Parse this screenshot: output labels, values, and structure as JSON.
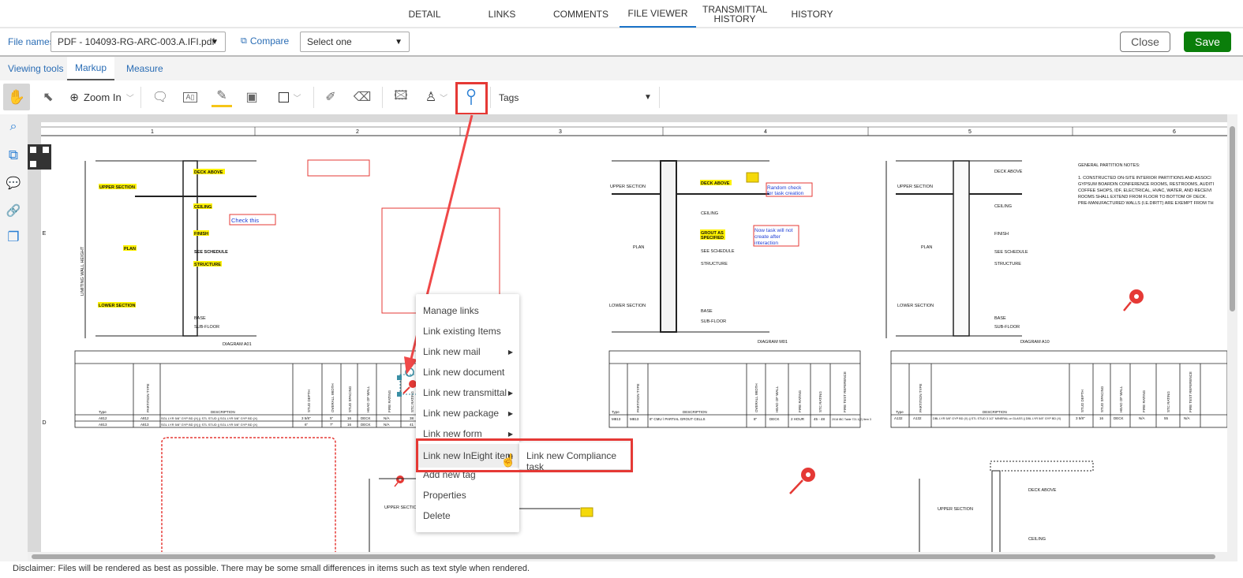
{
  "top_tabs": [
    "DETAIL",
    "LINKS",
    "COMMENTS",
    "FILE VIEWER",
    "TRANSMITTAL HISTORY",
    "HISTORY"
  ],
  "active_top_tab": "FILE VIEWER",
  "file_bar": {
    "label": "File names:",
    "file_value": "PDF - 104093-RG-ARC-003.A.IFI.pdf",
    "compare_label": "Compare",
    "compare_value": "Select one",
    "close_label": "Close",
    "save_label": "Save"
  },
  "sub_tabs": [
    "Viewing tools",
    "Markup",
    "Measure"
  ],
  "active_sub_tab": "Markup",
  "toolbar": {
    "zoom_label": "Zoom In",
    "tags_placeholder": "Tags"
  },
  "colors": {
    "save": "#0a7e0a",
    "accent": "#1a73c8",
    "highlight_red": "#e53935"
  },
  "drawing": {
    "column_numbers": [
      "1",
      "2",
      "3",
      "4",
      "5",
      "6"
    ],
    "row_letters": [
      "E",
      "D"
    ],
    "diagram_a": {
      "labels": [
        "DECK ABOVE",
        "UPPER SECTION",
        "CEILING",
        "FINISH",
        "PLAN",
        "SEE SCHEDULE",
        "STRUCTURE",
        "LOWER SECTION",
        "BASE",
        "SUB-FLOOR",
        "DIAGRAM A01",
        "LIMITING WALL HEIGHT"
      ]
    },
    "diagram_m": {
      "labels": [
        "DECK ABOVE",
        "UPPER SECTION",
        "CEILING",
        "GROUT AS",
        "SPECIFIED",
        "PLAN",
        "SEE SCHEDULE",
        "STRUCTURE",
        "LOWER SECTION",
        "BASE",
        "SUB-FLOOR",
        "DIAGRAM M01"
      ]
    },
    "diagram_a10": {
      "labels": [
        "DECK ABOVE",
        "UPPER SECTION",
        "CEILING",
        "FINISH",
        "PLAN",
        "SEE SCHEDULE",
        "STRUCTURE",
        "LOWER SECTION",
        "BASE",
        "SUB-FLOOR",
        "DIAGRAM A10"
      ]
    },
    "notes": [
      "GENERAL PARTITION NOTES:",
      "1. CONSTRUCTED ON-SITE INTERIOR PARTITIONS AND ASSOCI",
      "GYPSUM BOARDIN CONFERENCE ROOMS, RESTROOMS, AUDITI",
      "COFFEE SHOPS, IDF, ELECTRICAL, HVAC, WATER, AND RECEIVI",
      "ROOMS SHALL EXTEND FROM FLOOR TO BOTTOM OF DECK.",
      "PRE-MANUFACTURED WALLS (I.E.DIRTT) ARE EXEMPT FROM TH"
    ],
    "annotations": {
      "check_this": "Check this",
      "random_check": [
        "Random check",
        "for task creation"
      ],
      "now_task": [
        "Now task will not",
        "create after",
        "interaction"
      ]
    },
    "table1": {
      "headers": [
        "Type",
        "PARTITION TYPE",
        "DESCRIPTION",
        "STUD DEPTH",
        "OVERALL WIDTH",
        "STUD SPACING",
        "HEAD OF WALL",
        "FIRE RATING",
        "STC RATING"
      ],
      "rows": [
        [
          "A812",
          "A812",
          "SGL LYR 5/8\" GYP BD (X) || STL STUD || SGL LYR 5/8\" GYP BD (X)",
          "3 5/8\"",
          "5\"",
          "16",
          "DECK",
          "N/A",
          "38"
        ],
        [
          "A813",
          "A813",
          "SGL LYR 5/8\" GYP BD (X) || STL STUD || SGL LYR 5/8\" GYP BD (X)",
          "6\"",
          "7\"",
          "16",
          "DECK",
          "N/A",
          "41"
        ]
      ]
    },
    "table2": {
      "headers": [
        "Type",
        "PARTITION TYPE",
        "DESCRIPTION",
        "OVERALL WIDTH",
        "HEAD OF WALL",
        "FIRE RATING",
        "STC RATING",
        "FIRE TEST REFERENCE"
      ],
      "rows": [
        [
          "M813",
          "M813",
          "8\" CMU \\ PARTIAL GROUT CELLS",
          "8\"",
          "DECK",
          "2 HOUR",
          "45 - 48",
          "2018 IBC Table 721.1(2) Item 3"
        ]
      ]
    },
    "table3": {
      "headers": [
        "Type",
        "PARTITION TYPE",
        "DESCRIPTION",
        "STUD DEPTH",
        "STUD SPACING",
        "HEAD OF WALL",
        "FIRE RATING",
        "STC RATING",
        "FIRE TEST REFERENCE"
      ],
      "rows": [
        [
          "A132",
          "A132",
          "DBL LYR 5/8\" GYP BD (X) || STL STUD 3 1/2\" MINERAL or GLASS || DBL LYR 5/8\" GYP BD (X)",
          "3 5/8\"",
          "16",
          "DECK",
          "N/A",
          "55",
          "N/A"
        ]
      ]
    },
    "lower_labels": [
      "UPPER SECTION",
      "UPPER SECTION",
      "DECK ABOVE",
      "CEILING"
    ]
  },
  "context_menu": {
    "items": [
      "Manage links",
      "Link existing Items",
      "Link new mail",
      "Link new document",
      "Link new transmittal",
      "Link new package",
      "Link new form",
      "Link new InEight item",
      "Add new tag",
      "Properties",
      "Delete"
    ],
    "submenu_flags": [
      false,
      false,
      true,
      false,
      true,
      true,
      true,
      true,
      false,
      false,
      false
    ],
    "hovered": "Link new InEight item",
    "submenu": [
      "Link new Compliance task"
    ]
  },
  "disclaimer": "Disclaimer: Files will be rendered as best as possible. There may be some small differences in items such as text style when rendered."
}
